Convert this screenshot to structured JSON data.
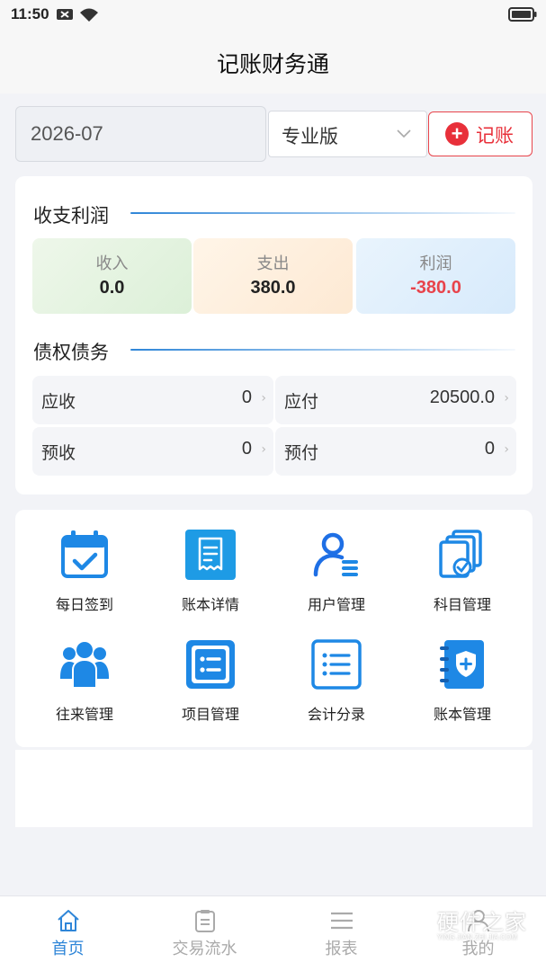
{
  "status_bar": {
    "time": "11:50",
    "icons": [
      "close-box-icon",
      "wifi-icon",
      "battery-icon"
    ]
  },
  "header": {
    "title": "记账财务通"
  },
  "filters": {
    "month": "2026-07",
    "edition_select": "专业版",
    "record_button": "记账"
  },
  "income_profit": {
    "title": "收支利润",
    "income_label": "收入",
    "income_value": "0.0",
    "expense_label": "支出",
    "expense_value": "380.0",
    "profit_label": "利润",
    "profit_value": "-380.0"
  },
  "debts": {
    "title": "债权债务",
    "items": [
      {
        "label": "应收",
        "value": "0"
      },
      {
        "label": "应付",
        "value": "20500.0"
      },
      {
        "label": "预收",
        "value": "0"
      },
      {
        "label": "预付",
        "value": "0"
      }
    ]
  },
  "menu": [
    {
      "label": "每日签到",
      "icon": "calendar-check-icon"
    },
    {
      "label": "账本详情",
      "icon": "receipt-icon"
    },
    {
      "label": "用户管理",
      "icon": "user-manage-icon"
    },
    {
      "label": "科目管理",
      "icon": "subject-docs-icon"
    },
    {
      "label": "往来管理",
      "icon": "people-group-icon"
    },
    {
      "label": "项目管理",
      "icon": "project-list-icon"
    },
    {
      "label": "会计分录",
      "icon": "journal-list-icon"
    },
    {
      "label": "账本管理",
      "icon": "ledger-shield-icon"
    }
  ],
  "tabs": [
    {
      "label": "首页",
      "icon": "home-icon",
      "active": true
    },
    {
      "label": "交易流水",
      "icon": "clipboard-icon",
      "active": false
    },
    {
      "label": "报表",
      "icon": "menu-lines-icon",
      "active": false
    },
    {
      "label": "我的",
      "icon": "profile-icon",
      "active": false
    }
  ],
  "watermark": {
    "text": "硬件之家",
    "sub": "YING JIAN ZHI JIA.COM"
  },
  "colors": {
    "primary": "#2f86d8",
    "danger": "#e8303a",
    "icon_blue": "#1e88e5"
  }
}
